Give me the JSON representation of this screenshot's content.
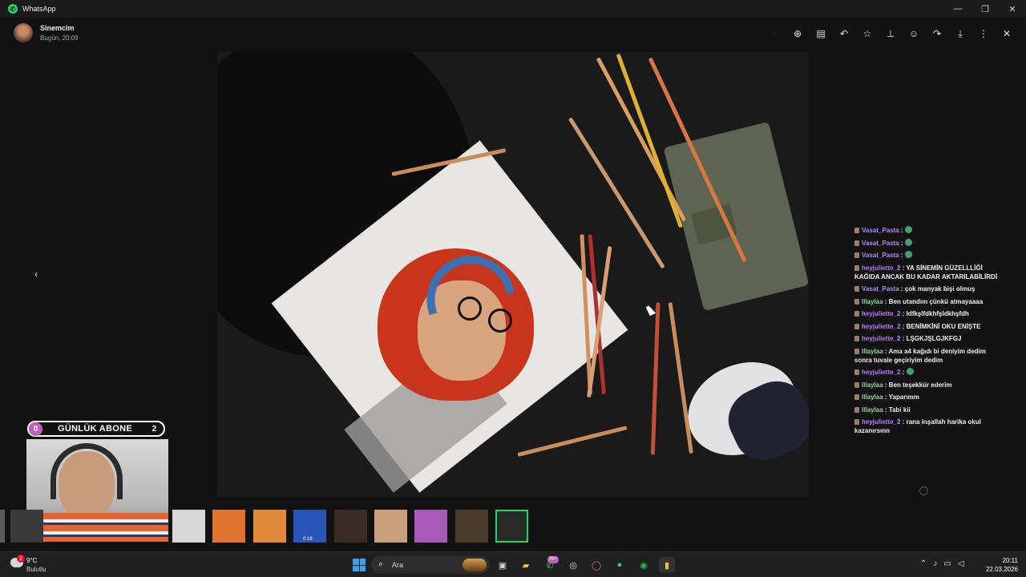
{
  "window": {
    "app_title": "WhatsApp",
    "controls": [
      "—",
      "❐",
      "✕"
    ]
  },
  "header": {
    "contact_name": "Sinemcim",
    "timestamp": "Bugün, 20:09",
    "icons": [
      "search-icon",
      "zoom-in-icon",
      "go-to-message-icon",
      "reply-icon",
      "star-icon",
      "pin-icon",
      "react-icon",
      "forward-icon",
      "download-icon",
      "more-icon",
      "close-icon"
    ]
  },
  "media": {
    "nav_prev": "‹"
  },
  "subscriber_widget": {
    "left_count": "0",
    "label": "GÜNLÜK ABONE",
    "right_count": "2"
  },
  "chat": [
    {
      "user": "Vasat_Pasta",
      "color": "#a78bfa",
      "text": "",
      "emoji": true
    },
    {
      "user": "Vasat_Pasta",
      "color": "#a78bfa",
      "text": "",
      "emoji": true
    },
    {
      "user": "Vasat_Pasta",
      "color": "#a78bfa",
      "text": "",
      "emoji": true
    },
    {
      "user": "heyjuliette_2",
      "color": "#b57bff",
      "text": "YA SİNEMİN GÜZELLLİĞİ KAĞIDA ANCAK BU KADAR AKTARILABİLİRDİ",
      "emoji": false
    },
    {
      "user": "Vasat_Pasta",
      "color": "#a78bfa",
      "text": "çok manyak bişi olmuş",
      "emoji": false
    },
    {
      "user": "lllaylaa",
      "color": "#8fd88f",
      "text": "Ben utandım çünkü atmayaaaa",
      "emoji": false
    },
    {
      "user": "heyjuliette_2",
      "color": "#b57bff",
      "text": "ldfkşlfdkhfşldkhşfdh",
      "emoji": false
    },
    {
      "user": "heyjuliette_2",
      "color": "#b57bff",
      "text": "BENİMKİNİ OKU ENİŞTE",
      "emoji": false
    },
    {
      "user": "heyjuliette_2",
      "color": "#b57bff",
      "text": "LŞGKJŞLGJKFGJ",
      "emoji": false
    },
    {
      "user": "lllaylaa",
      "color": "#8fd88f",
      "text": "Ama a4 kağıdı bi deniyim dedim sonra tuvale geçiriyim dedim",
      "emoji": false
    },
    {
      "user": "heyjuliette_2",
      "color": "#b57bff",
      "text": "",
      "emoji": true
    },
    {
      "user": "lllaylaa",
      "color": "#8fd88f",
      "text": "Ben teşekkür ederim",
      "emoji": false
    },
    {
      "user": "lllaylaa",
      "color": "#8fd88f",
      "text": "Yaparımm",
      "emoji": false
    },
    {
      "user": "lllaylaa",
      "color": "#8fd88f",
      "text": "Tabi kii",
      "emoji": false
    },
    {
      "user": "heyjuliette_2",
      "color": "#b57bff",
      "text": "rana inşallah harika okul kazanırsınn",
      "emoji": false
    }
  ],
  "thumbnails": {
    "items": [
      {
        "color": "#5b5b5b",
        "duration": ""
      },
      {
        "color": "#3a3a3a",
        "duration": ""
      },
      {
        "color": "#d7d7d7",
        "duration": ""
      },
      {
        "color": "#e0732e",
        "duration": ""
      },
      {
        "color": "#e08a3a",
        "duration": ""
      },
      {
        "color": "#2a55b8",
        "duration": "0:16"
      },
      {
        "color": "#3a2c24",
        "duration": ""
      },
      {
        "color": "#caa07a",
        "duration": ""
      },
      {
        "color": "#a85ab8",
        "duration": ""
      },
      {
        "color": "#4a3a2a",
        "duration": ""
      },
      {
        "color": "#2a2a2a",
        "duration": ""
      }
    ],
    "selected_index": 10
  },
  "taskbar": {
    "weather_temp": "9°C",
    "weather_desc": "Bulutlu",
    "weather_badge": "2",
    "search_placeholder": "Ara",
    "whatsapp_badge": "99+",
    "time": "20:11",
    "date": "22.03.2026"
  }
}
